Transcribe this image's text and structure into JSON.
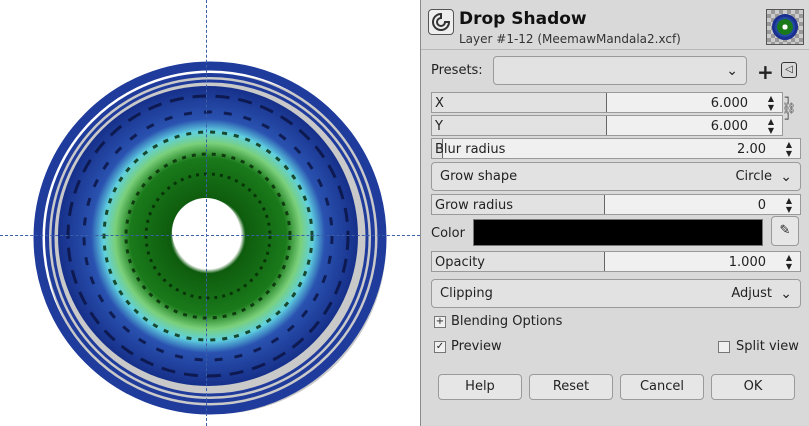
{
  "canvas": {
    "colors": {
      "outer_ring": "#1f3b9c",
      "inner_green": "#1a7a1a",
      "glow": "#5fd0e0"
    }
  },
  "dialog": {
    "title": "Drop Shadow",
    "subtitle": "Layer #1-12 (MeemawMandala2.xcf)",
    "presets": {
      "label": "Presets:",
      "value": ""
    },
    "x": {
      "label": "X",
      "value": "6.000",
      "fill": 0.5
    },
    "y": {
      "label": "Y",
      "value": "6.000",
      "fill": 0.5
    },
    "blur": {
      "label": "Blur radius",
      "value": "2.00",
      "fill": 0.03
    },
    "grow_shape": {
      "label": "Grow shape",
      "value": "Circle"
    },
    "grow_radius": {
      "label": "Grow radius",
      "value": "0",
      "fill": 0.47
    },
    "color": {
      "label": "Color",
      "swatch": "#000000"
    },
    "opacity": {
      "label": "Opacity",
      "value": "1.000",
      "fill": 0.47
    },
    "clipping": {
      "label": "Clipping",
      "value": "Adjust"
    },
    "blending": {
      "label": "Blending Options"
    },
    "preview": {
      "label": "Preview",
      "checked": true
    },
    "split_view": {
      "label": "Split view",
      "checked": false
    },
    "buttons": {
      "help": "Help",
      "reset": "Reset",
      "cancel": "Cancel",
      "ok": "OK"
    }
  }
}
